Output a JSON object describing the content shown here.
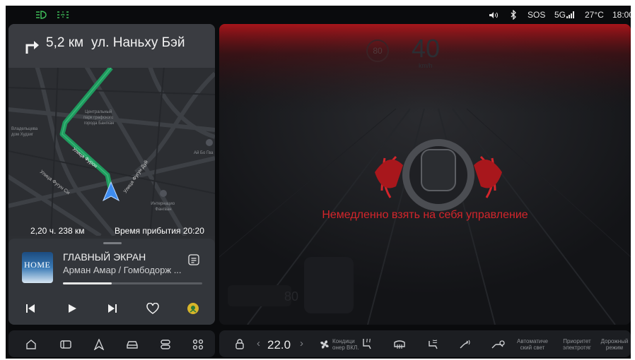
{
  "status_bar": {
    "volume_icon": "speaker-icon",
    "bluetooth_icon": "bluetooth-icon",
    "sos": "SOS",
    "network": "5G",
    "temperature": "27°C",
    "time": "18:00"
  },
  "navigation": {
    "distance": "5,2 км",
    "street": "ул. Наньху Бэй",
    "remaining": "2,20 ч. 238 км",
    "arrival": "Время прибытия 20:20",
    "map_labels": {
      "street_furong": "Улица Фурон",
      "street_dui": "Улица Фугун Дуй",
      "street_si": "Улица Фугун Си",
      "park": [
        "Центральный",
        "парк графского",
        "города Бангкан"
      ],
      "house": [
        "Владельцева",
        "дом Худзиг"
      ],
      "metro": [
        "Интернацио",
        "Фангван"
      ],
      "stop": "Ай Бо Гва"
    },
    "accent_color": "#1f9a5e"
  },
  "media": {
    "album_text": "HOME",
    "title": "ГЛАВНЫЙ ЭКРАН",
    "artist": "Арман Амар / Гомбодорж ...",
    "progress": 0.35
  },
  "driving": {
    "speed_limit": "80",
    "speed": "40",
    "speed_unit": "km/h",
    "warning": "Немедленно взять на себя управление",
    "warning_color": "#d4252b",
    "ghost_speed": "80"
  },
  "dock": {
    "items": [
      "home-icon",
      "card-icon",
      "navigation-icon",
      "car-icon",
      "settings-icon",
      "apps-icon"
    ]
  },
  "climate": {
    "temperature": "22.0",
    "ac_label": [
      "Кондици",
      "онер ВКЛ."
    ],
    "auto_light": [
      "Автоматиче",
      "ский свет"
    ],
    "electric": [
      "Приоритет",
      "электротяг"
    ],
    "road_mode": [
      "Дорожный",
      "режим"
    ]
  }
}
